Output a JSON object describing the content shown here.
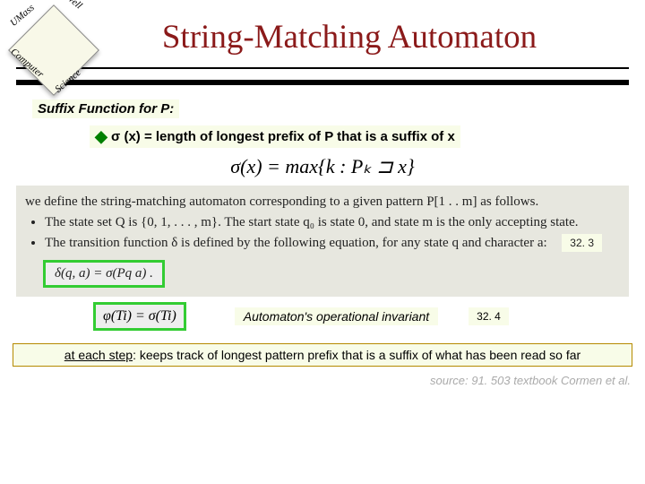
{
  "logo": {
    "top_left": "UMass",
    "top_right": "Lowell",
    "bottom_left": "Computer",
    "bottom_right": "Science"
  },
  "title": "String-Matching Automaton",
  "suffix_label": "Suffix Function for P:",
  "sigma_def_prefix": "σ",
  "sigma_def_rest": "(x) = length of longest prefix of P that is a suffix of x",
  "formula": "σ(x) = max{k : Pₖ ⊐ x}",
  "scan": {
    "intro": "we define the string-matching automaton corresponding to a given pattern P[1 . . m] as follows.",
    "bullet1": "The state set Q is {0, 1, . . . , m}. The start state q₀ is state 0, and state m is the only accepting state.",
    "bullet2": "The transition function δ is defined by the following equation, for any state q and character a:",
    "delta_formula": "δ(q, a) = σ(Pq a) ."
  },
  "tag_323": "32. 3",
  "phi_formula": "φ(Ti) = σ(Ti)",
  "invariant_label": "Automaton's operational invariant",
  "tag_324": "32. 4",
  "bottom_note_u": "at each step",
  "bottom_note_rest": ": keeps track of longest pattern prefix that is a suffix of what has been read so far",
  "source": "source: 91. 503 textbook Cormen et al."
}
